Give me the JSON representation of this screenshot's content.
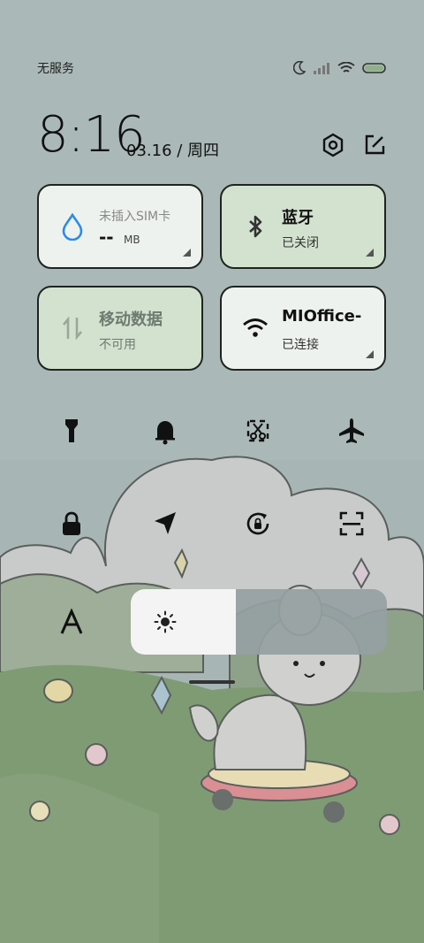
{
  "status_bar": {
    "carrier": "无服务"
  },
  "header": {
    "time": "8:16",
    "date": "03.16 / 周四"
  },
  "tiles": {
    "data_usage": {
      "title": "未插入SIM卡",
      "value": "--",
      "unit": "MB"
    },
    "bluetooth": {
      "title": "蓝牙",
      "status": "已关闭"
    },
    "mobile_data": {
      "title": "移动数据",
      "status": "不可用"
    },
    "wifi": {
      "title": "MIOffice-",
      "status": "已连接"
    }
  },
  "toggles_row1": [
    "flashlight-icon",
    "bell-icon",
    "screenshot-icon",
    "airplane-icon"
  ],
  "toggles_row2": [
    "lock-icon",
    "location-icon",
    "rotation-lock-icon",
    "scan-icon"
  ],
  "brightness": {
    "level": 0.41
  },
  "colors": {
    "tile_active": "#d3e2cf",
    "tile_inactive": "#eef2ee",
    "accent_blue": "#2b8ce8"
  }
}
